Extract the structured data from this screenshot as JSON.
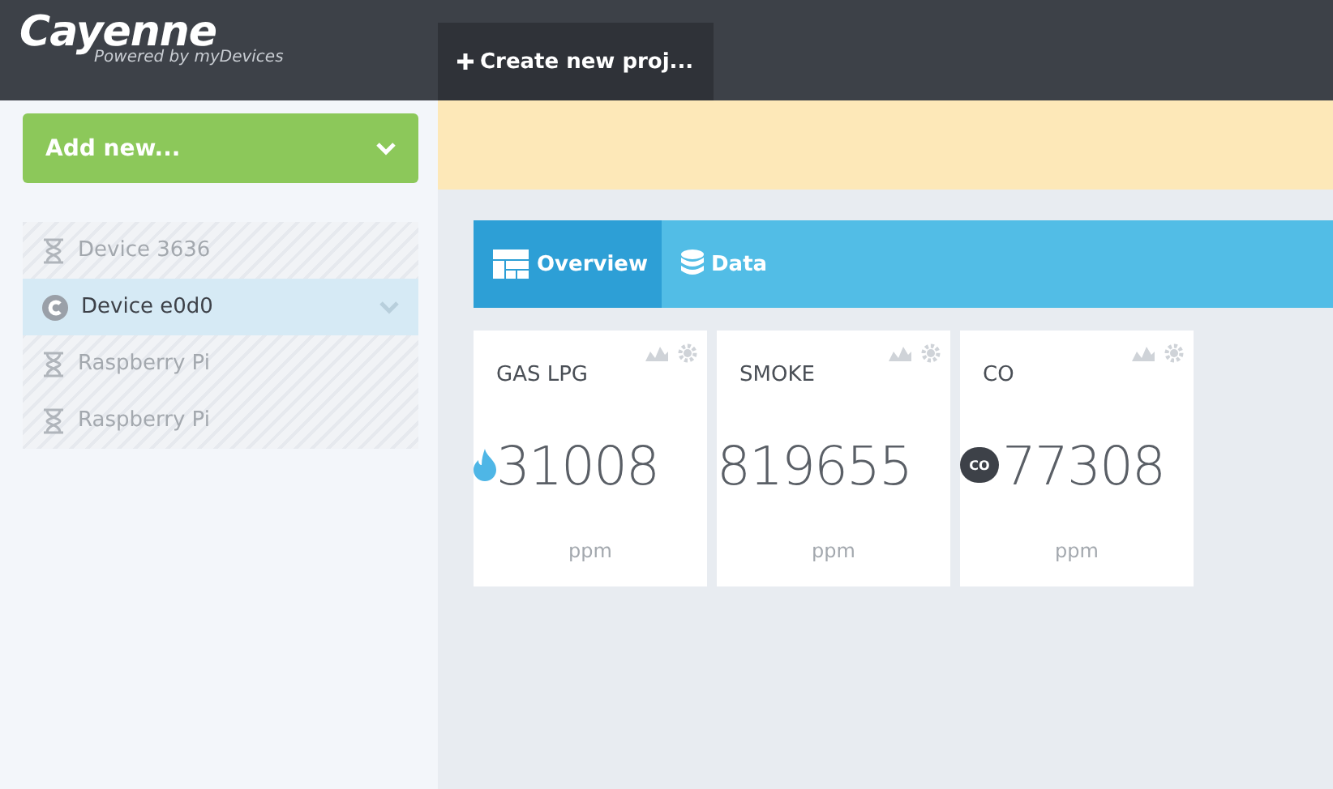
{
  "header": {
    "logo": "Cayenne",
    "tagline": "Powered by myDevices",
    "create_button": "Create new proj..."
  },
  "sidebar": {
    "add_button": "Add new...",
    "devices": [
      {
        "name": "Device 3636",
        "kind": "pending",
        "selected": false
      },
      {
        "name": "Device e0d0",
        "kind": "online",
        "selected": true
      },
      {
        "name": "Raspberry Pi",
        "kind": "pending",
        "selected": false
      },
      {
        "name": "Raspberry Pi",
        "kind": "pending",
        "selected": false
      }
    ]
  },
  "tabs": [
    {
      "label": "Overview",
      "kind": "overview",
      "selected": true
    },
    {
      "label": "Data",
      "kind": "data",
      "selected": false
    }
  ],
  "widgets": [
    {
      "title": "GAS LPG",
      "value": "31008",
      "unit": "ppm",
      "kind": "flame"
    },
    {
      "title": "SMOKE",
      "value": "819655",
      "unit": "ppm",
      "kind": "none"
    },
    {
      "title": "CO",
      "value": "77308",
      "unit": "ppm",
      "kind": "cloud",
      "badge": "CO"
    }
  ]
}
